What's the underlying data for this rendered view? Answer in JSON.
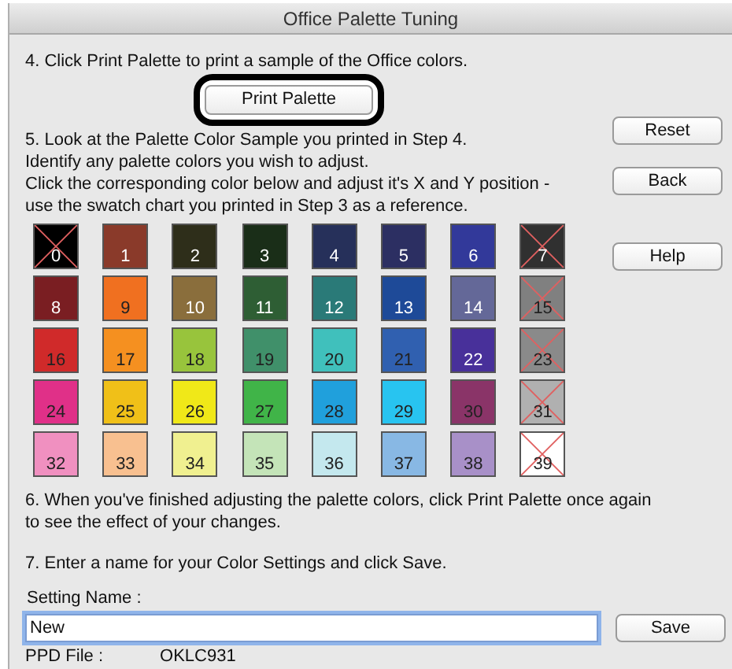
{
  "window": {
    "title": "Office Palette Tuning"
  },
  "step4": "4. Click Print Palette to print a sample of the Office colors.",
  "print_button": {
    "label": "Print Palette",
    "highlighted": true
  },
  "step5": [
    "5. Look at the Palette Color Sample you printed in Step 4.",
    "Identify any palette colors you wish to adjust.",
    "Click the corresponding color below and adjust it's X and Y position -",
    "use the swatch chart you printed in Step 3 as a reference."
  ],
  "side_buttons": [
    "Reset",
    "Back",
    "Help"
  ],
  "swatches": [
    {
      "label": "0",
      "color": "#000000",
      "disabled": true,
      "light_text": true
    },
    {
      "label": "1",
      "color": "#8a3a2a",
      "disabled": false,
      "light_text": true
    },
    {
      "label": "2",
      "color": "#2e2e1a",
      "disabled": false,
      "light_text": true
    },
    {
      "label": "3",
      "color": "#1a2e18",
      "disabled": false,
      "light_text": true
    },
    {
      "label": "4",
      "color": "#26305a",
      "disabled": false,
      "light_text": true
    },
    {
      "label": "5",
      "color": "#2c2f62",
      "disabled": false,
      "light_text": true
    },
    {
      "label": "6",
      "color": "#32399a",
      "disabled": false,
      "light_text": true
    },
    {
      "label": "7",
      "color": "#303030",
      "disabled": true,
      "light_text": true
    },
    {
      "label": "8",
      "color": "#7a1e22",
      "disabled": false,
      "light_text": true
    },
    {
      "label": "9",
      "color": "#f07020",
      "disabled": false,
      "light_text": false
    },
    {
      "label": "10",
      "color": "#8a6e3c",
      "disabled": false,
      "light_text": true
    },
    {
      "label": "11",
      "color": "#2e5e34",
      "disabled": false,
      "light_text": true
    },
    {
      "label": "12",
      "color": "#2a7a78",
      "disabled": false,
      "light_text": true
    },
    {
      "label": "13",
      "color": "#1e4a98",
      "disabled": false,
      "light_text": true
    },
    {
      "label": "14",
      "color": "#646898",
      "disabled": false,
      "light_text": true
    },
    {
      "label": "15",
      "color": "#808080",
      "disabled": true,
      "light_text": false
    },
    {
      "label": "16",
      "color": "#d02a2a",
      "disabled": false,
      "light_text": false
    },
    {
      "label": "17",
      "color": "#f59020",
      "disabled": false,
      "light_text": false
    },
    {
      "label": "18",
      "color": "#98c43c",
      "disabled": false,
      "light_text": false
    },
    {
      "label": "19",
      "color": "#40906a",
      "disabled": false,
      "light_text": false
    },
    {
      "label": "20",
      "color": "#40c0bc",
      "disabled": false,
      "light_text": false
    },
    {
      "label": "21",
      "color": "#3060b0",
      "disabled": false,
      "light_text": false
    },
    {
      "label": "22",
      "color": "#48309a",
      "disabled": false,
      "light_text": true
    },
    {
      "label": "23",
      "color": "#8a8a8a",
      "disabled": true,
      "light_text": false
    },
    {
      "label": "24",
      "color": "#e03088",
      "disabled": false,
      "light_text": false
    },
    {
      "label": "25",
      "color": "#f0c018",
      "disabled": false,
      "light_text": false
    },
    {
      "label": "26",
      "color": "#f0e818",
      "disabled": false,
      "light_text": false
    },
    {
      "label": "27",
      "color": "#40b448",
      "disabled": false,
      "light_text": false
    },
    {
      "label": "28",
      "color": "#20a0dc",
      "disabled": false,
      "light_text": false
    },
    {
      "label": "29",
      "color": "#28c4f0",
      "disabled": false,
      "light_text": false
    },
    {
      "label": "30",
      "color": "#8a3468",
      "disabled": false,
      "light_text": false
    },
    {
      "label": "31",
      "color": "#b0b0b0",
      "disabled": true,
      "light_text": false
    },
    {
      "label": "32",
      "color": "#f090c0",
      "disabled": false,
      "light_text": false
    },
    {
      "label": "33",
      "color": "#f8c090",
      "disabled": false,
      "light_text": false
    },
    {
      "label": "34",
      "color": "#f0f090",
      "disabled": false,
      "light_text": false
    },
    {
      "label": "35",
      "color": "#c4e4b8",
      "disabled": false,
      "light_text": false
    },
    {
      "label": "36",
      "color": "#c4e8ee",
      "disabled": false,
      "light_text": false
    },
    {
      "label": "37",
      "color": "#88b8e4",
      "disabled": false,
      "light_text": false
    },
    {
      "label": "38",
      "color": "#a890c8",
      "disabled": false,
      "light_text": false
    },
    {
      "label": "39",
      "color": "#ffffff",
      "disabled": true,
      "light_text": false
    }
  ],
  "step6": "6. When you've finished adjusting the palette colors, click Print Palette once again to see the effect of your changes.",
  "step7": "7. Enter a name for your Color Settings and click Save.",
  "setting_name": {
    "label": "Setting Name :",
    "value": "New"
  },
  "save_button": "Save",
  "ppd_file": {
    "label": "PPD File :",
    "value": "OKLC931"
  }
}
